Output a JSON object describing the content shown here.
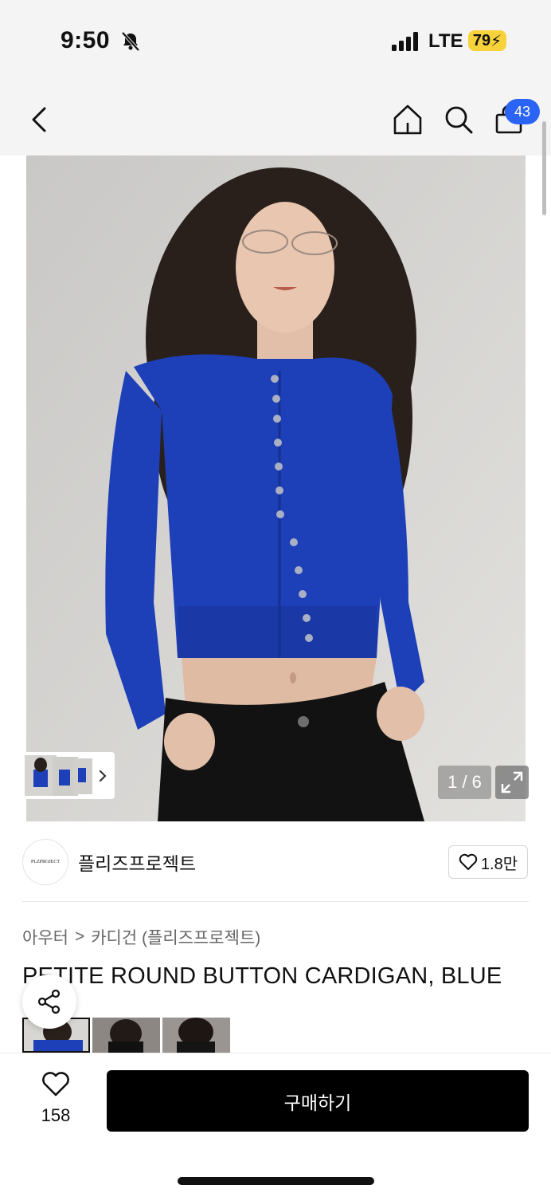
{
  "status": {
    "time": "9:50",
    "network": "LTE",
    "battery": "79"
  },
  "nav": {
    "cart_count": "43"
  },
  "gallery": {
    "counter": "1 / 6"
  },
  "brand": {
    "logo_text": "PLZPROJECT",
    "name": "플리즈프로젝트",
    "likes": "1.8만"
  },
  "breadcrumb": {
    "level1": "아우터",
    "separator": ">",
    "level2": "카디건 (플리즈프로젝트)"
  },
  "product": {
    "title": "PETITE ROUND BUTTON CARDIGAN, BLUE"
  },
  "bottom": {
    "wish_count": "158",
    "buy_label": "구매하기"
  },
  "colors": {
    "accent_badge": "#2b63f5",
    "cardigan": "#1d3fb8",
    "buy_button": "#000000",
    "battery": "#f7d23a"
  }
}
